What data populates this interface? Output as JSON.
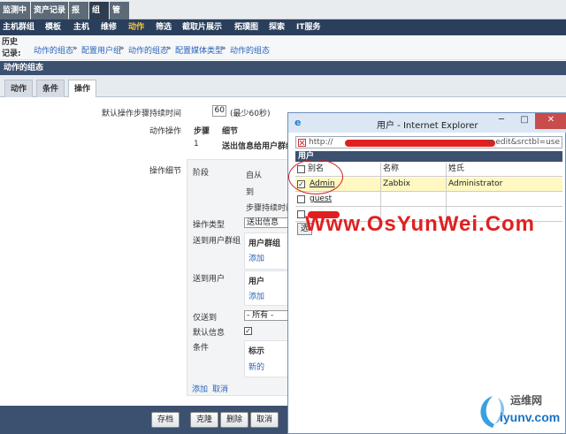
{
  "top_tabs": [
    "监测中",
    "资产记录",
    "报表",
    "组态",
    "管理"
  ],
  "main_nav": [
    "主机群组",
    "模板",
    "主机",
    "维修",
    "动作",
    "筛选",
    "截取片展示",
    "拓璞图",
    "探索",
    "IT服务"
  ],
  "history": {
    "label": "历史记录:",
    "crumbs": [
      "动作的组态",
      "配置用户组",
      "动作的组态",
      "配置媒体类型",
      "动作的组态"
    ],
    "sep": "»"
  },
  "form": {
    "header": "动作的组态",
    "tabs": [
      "动作",
      "条件",
      "操作"
    ],
    "default_duration_label": "默认操作步骤持续时间",
    "default_duration_value": "60",
    "default_duration_hint": "(最少60秒)",
    "operations_label": "动作操作",
    "ops_col_step": "步骤",
    "ops_col_detail": "细节",
    "ops_row_step": "1",
    "ops_row_detail": "送出信息给用户群组",
    "op_details_label": "操作细节",
    "phase_label": "阶段",
    "from_label": "自从",
    "to_label": "到",
    "step_duration_label": "步骤持续时间",
    "op_type_label": "操作类型",
    "op_type_value": "送出信息",
    "send_to_groups_label": "送到用户群组",
    "user_groups_head": "用户群组",
    "add_1": "添加",
    "send_to_users_label": "送到用户",
    "users_head": "用户",
    "add_2": "添加",
    "only_send_label": "仅送到",
    "only_send_value": "- 所有 -",
    "default_msg_label": "默认信息",
    "default_msg_check": "✓",
    "conditions_label": "条件",
    "tag_head": "标示",
    "new_link": "新的",
    "add_link": "添加",
    "cancel_link": "取消"
  },
  "bottom_buttons": [
    "存档",
    "克隆",
    "删除",
    "取消"
  ],
  "popup": {
    "title": "用户 - Internet Explorer",
    "win_min": "─",
    "win_max": "□",
    "win_close": "✕",
    "address_prefix": "http://",
    "address_tail": "n.edit&srctbl=use",
    "table_title": "用户",
    "col_alias": "别名",
    "col_name": "名称",
    "col_surname": "姓氏",
    "rows": [
      {
        "alias": "Admin",
        "name": "Zabbix",
        "surname": "Administrator",
        "checked": true
      },
      {
        "alias": "guest",
        "name": "",
        "surname": "",
        "checked": false
      },
      {
        "alias": "",
        "name": "",
        "surname": "",
        "checked": false
      }
    ],
    "check_mark": "✓",
    "select_button": "选"
  },
  "watermark": "Www.OsYunWei.Com",
  "logo": {
    "cn": "运维网",
    "en": "iyunv.com"
  },
  "colors": {
    "nav_bg": "#2a3f5b",
    "accent": "#f6c642",
    "header_bg": "#3c5070",
    "highlight_row": "#fff8c2",
    "watermark": "#e02020"
  }
}
